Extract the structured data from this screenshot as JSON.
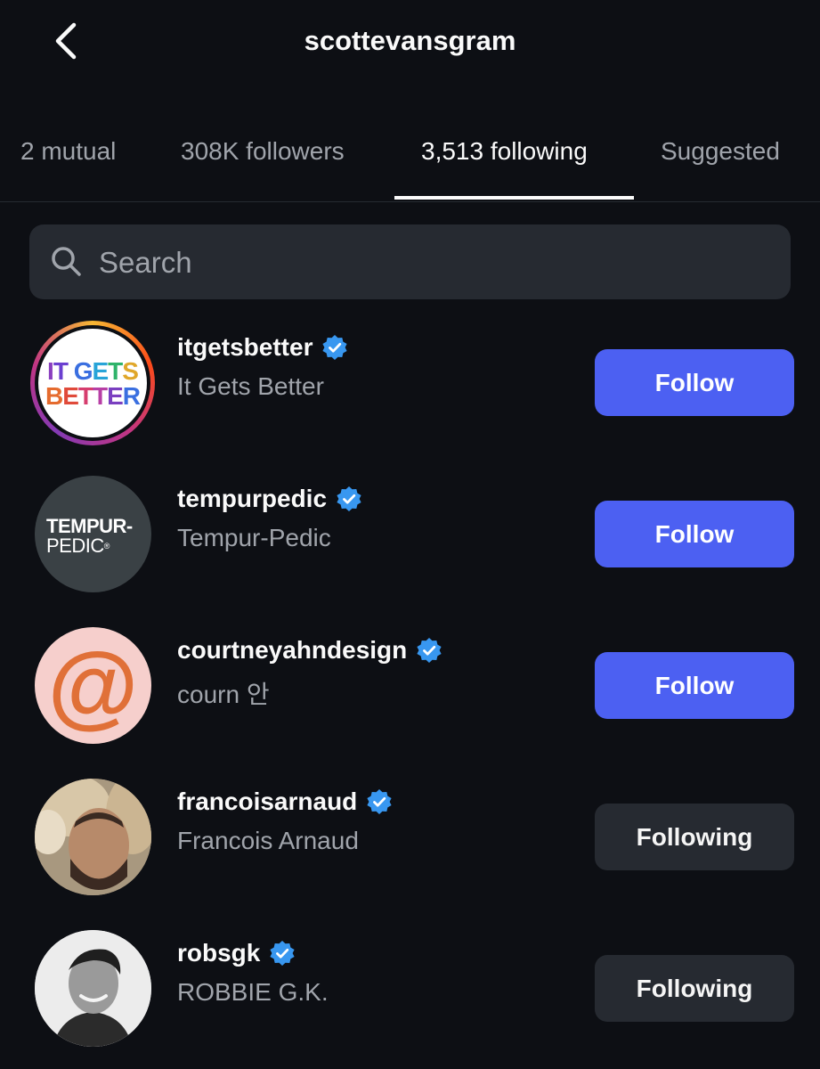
{
  "header": {
    "title": "scottevansgram"
  },
  "tabs": [
    {
      "label": "2 mutual",
      "active": false
    },
    {
      "label": "308K followers",
      "active": false
    },
    {
      "label": "3,513 following",
      "active": true
    },
    {
      "label": "Suggested",
      "active": false
    }
  ],
  "search": {
    "placeholder": "Search"
  },
  "colors": {
    "background": "#0d0f14",
    "follow_button": "#4c60f2",
    "following_button": "#262a31",
    "verified": "#3897f0"
  },
  "accounts": [
    {
      "username": "itgetsbetter",
      "name": "It Gets Better",
      "verified": true,
      "button": "Follow",
      "avatar_text": [
        "IT GETS",
        "BETTER"
      ],
      "has_story_ring": true
    },
    {
      "username": "tempurpedic",
      "name": "Tempur-Pedic",
      "verified": true,
      "button": "Follow",
      "avatar_text": [
        "TEMPUR-",
        "PEDIC"
      ]
    },
    {
      "username": "courtneyahndesign",
      "name": "courn 안",
      "verified": true,
      "button": "Follow",
      "avatar_text": [
        "@"
      ]
    },
    {
      "username": "francoisarnaud",
      "name": "Francois Arnaud",
      "verified": true,
      "button": "Following"
    },
    {
      "username": "robsgk",
      "name": "ROBBIE G.K.",
      "verified": true,
      "button": "Following"
    }
  ]
}
